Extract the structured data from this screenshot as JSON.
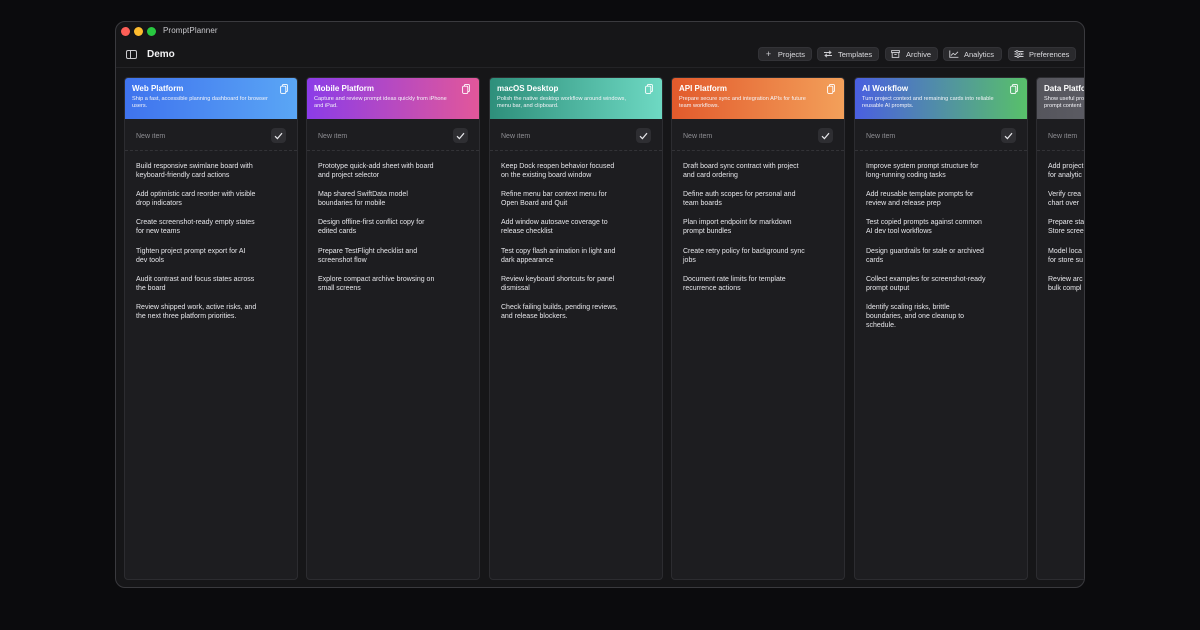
{
  "app": {
    "title": "PromptPlanner",
    "board_title": "Demo"
  },
  "toolbar": {
    "buttons": [
      {
        "label": "Projects",
        "icon": "plus-icon"
      },
      {
        "label": "Templates",
        "icon": "arrows-icon"
      },
      {
        "label": "Archive",
        "icon": "archive-box-icon"
      },
      {
        "label": "Analytics",
        "icon": "chart-icon"
      },
      {
        "label": "Preferences",
        "icon": "sliders-icon"
      }
    ]
  },
  "new_item_placeholder": "New item",
  "columns": [
    {
      "title": "Web Platform",
      "description": "Ship a fast, accessible planning dashboard for browser users.",
      "gradient": [
        "#3f73ee",
        "#5aa6f5"
      ],
      "cards": [
        "Build responsive swimlane board with keyboard-friendly card actions",
        "Add optimistic card reorder with visible drop indicators",
        "Create screenshot-ready empty states for new teams",
        "Tighten project prompt export for AI dev tools",
        "Audit contrast and focus states across the board",
        "Review shipped work, active risks, and the next three platform priorities."
      ]
    },
    {
      "title": "Mobile Platform",
      "description": "Capture and review prompt ideas quickly from iPhone and iPad.",
      "gradient": [
        "#8b3ce8",
        "#e2579a"
      ],
      "cards": [
        "Prototype quick-add sheet with board and project selector",
        "Map shared SwiftData model boundaries for mobile",
        "Design offline-first conflict copy for edited cards",
        "Prepare TestFlight checklist and screenshot flow",
        "Explore compact archive browsing on small screens"
      ]
    },
    {
      "title": "macOS Desktop",
      "description": "Polish the native desktop workflow around windows, menu bar, and clipboard.",
      "gradient": [
        "#2e8f7b",
        "#6ed9c3"
      ],
      "cards": [
        "Keep Dock reopen behavior focused on the existing board window",
        "Refine menu bar context menu for Open Board and Quit",
        "Add window autosave coverage to release checklist",
        "Test copy flash animation in light and dark appearance",
        "Review keyboard shortcuts for panel dismissal",
        "Check failing builds, pending reviews, and release blockers."
      ]
    },
    {
      "title": "API Platform",
      "description": "Prepare secure sync and integration APIs for future team workflows.",
      "gradient": [
        "#e25a2c",
        "#f3a05a"
      ],
      "cards": [
        "Draft board sync contract with project and card ordering",
        "Define auth scopes for personal and team boards",
        "Plan import endpoint for markdown prompt bundles",
        "Create retry policy for background sync jobs",
        "Document rate limits for template recurrence actions"
      ]
    },
    {
      "title": "AI Workflow",
      "description": "Turn project context and remaining cards into reliable reusable AI prompts.",
      "gradient": [
        "#4a5fe0",
        "#58c06a"
      ],
      "cards": [
        "Improve system prompt structure for long-running coding tasks",
        "Add reusable template prompts for review and release prep",
        "Test copied prompts against common AI dev tool workflows",
        "Design guardrails for stale or archived cards",
        "Collect examples for screenshot-ready prompt output",
        "Identify scaling risks, brittle boundaries, and one cleanup to schedule."
      ]
    },
    {
      "title": "Data Platfo",
      "description": "Show useful pro prompt content",
      "gradient": [
        "#55555c",
        "#6a6a72"
      ],
      "cards": [
        "Add project for analytic",
        "Verify crea chart over",
        "Prepare sta Store scree",
        "Model loca for store su",
        "Review arc bulk compl"
      ]
    }
  ]
}
